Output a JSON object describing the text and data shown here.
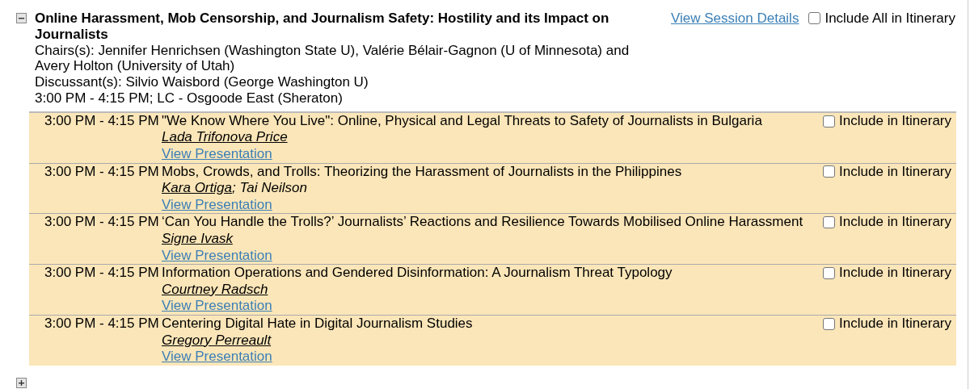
{
  "session": {
    "expanded": true,
    "title": "Online Harassment, Mob Censorship, and Journalism Safety: Hostility and its Impact on Journalists",
    "details_link": "View Session Details",
    "include_all": {
      "label": "Include All in Itinerary",
      "checked": false
    },
    "chairs": "Chairs(s): Jennifer Henrichsen (Washington State U), Valérie Bélair-Gagnon (U of Minnesota) and Avery Holton (University of Utah)",
    "discussant": "Discussant(s): Silvio Waisbord (George Washington U)",
    "time_place": "3:00 PM - 4:15 PM; LC - Osgoode East (Sheraton)",
    "presentations": [
      {
        "time": "3:00 PM - 4:15 PM",
        "title": "\"We Know Where You Live\": Online, Physical and Legal Threats to Safety of Journalists in Bulgaria",
        "authors": [
          {
            "name": "Lada Trifonova Price",
            "presenter": true
          }
        ],
        "link": "View Presentation",
        "include": {
          "label": "Include in Itinerary",
          "checked": false
        }
      },
      {
        "time": "3:00 PM - 4:15 PM",
        "title": "Mobs, Crowds, and Trolls: Theorizing the Harassment of Journalists in the Philippines",
        "authors": [
          {
            "name": "Kara Ortiga",
            "presenter": true
          },
          {
            "name": "Tai Neilson",
            "presenter": false
          }
        ],
        "author_separator": ";",
        "link": "View Presentation",
        "include": {
          "label": "Include in Itinerary",
          "checked": false
        }
      },
      {
        "time": "3:00 PM - 4:15 PM",
        "title": "‘Can You Handle the Trolls?’ Journalists’ Reactions and Resilience Towards Mobilised Online Harassment",
        "authors": [
          {
            "name": "Signe Ivask",
            "presenter": true
          }
        ],
        "link": "View Presentation",
        "include": {
          "label": "Include in Itinerary",
          "checked": false
        }
      },
      {
        "time": "3:00 PM - 4:15 PM",
        "title": "Information Operations and Gendered Disinformation: A Journalism Threat Typology",
        "authors": [
          {
            "name": "Courtney Radsch",
            "presenter": true
          }
        ],
        "link": "View Presentation",
        "include": {
          "label": "Include in Itinerary",
          "checked": false
        }
      },
      {
        "time": "3:00 PM - 4:15 PM",
        "title": "Centering Digital Hate in Digital Journalism Studies",
        "authors": [
          {
            "name": "Gregory Perreault",
            "presenter": true
          }
        ],
        "link": "View Presentation",
        "include": {
          "label": "Include in Itinerary",
          "checked": false
        }
      }
    ]
  },
  "next_session": {
    "expanded": false
  }
}
